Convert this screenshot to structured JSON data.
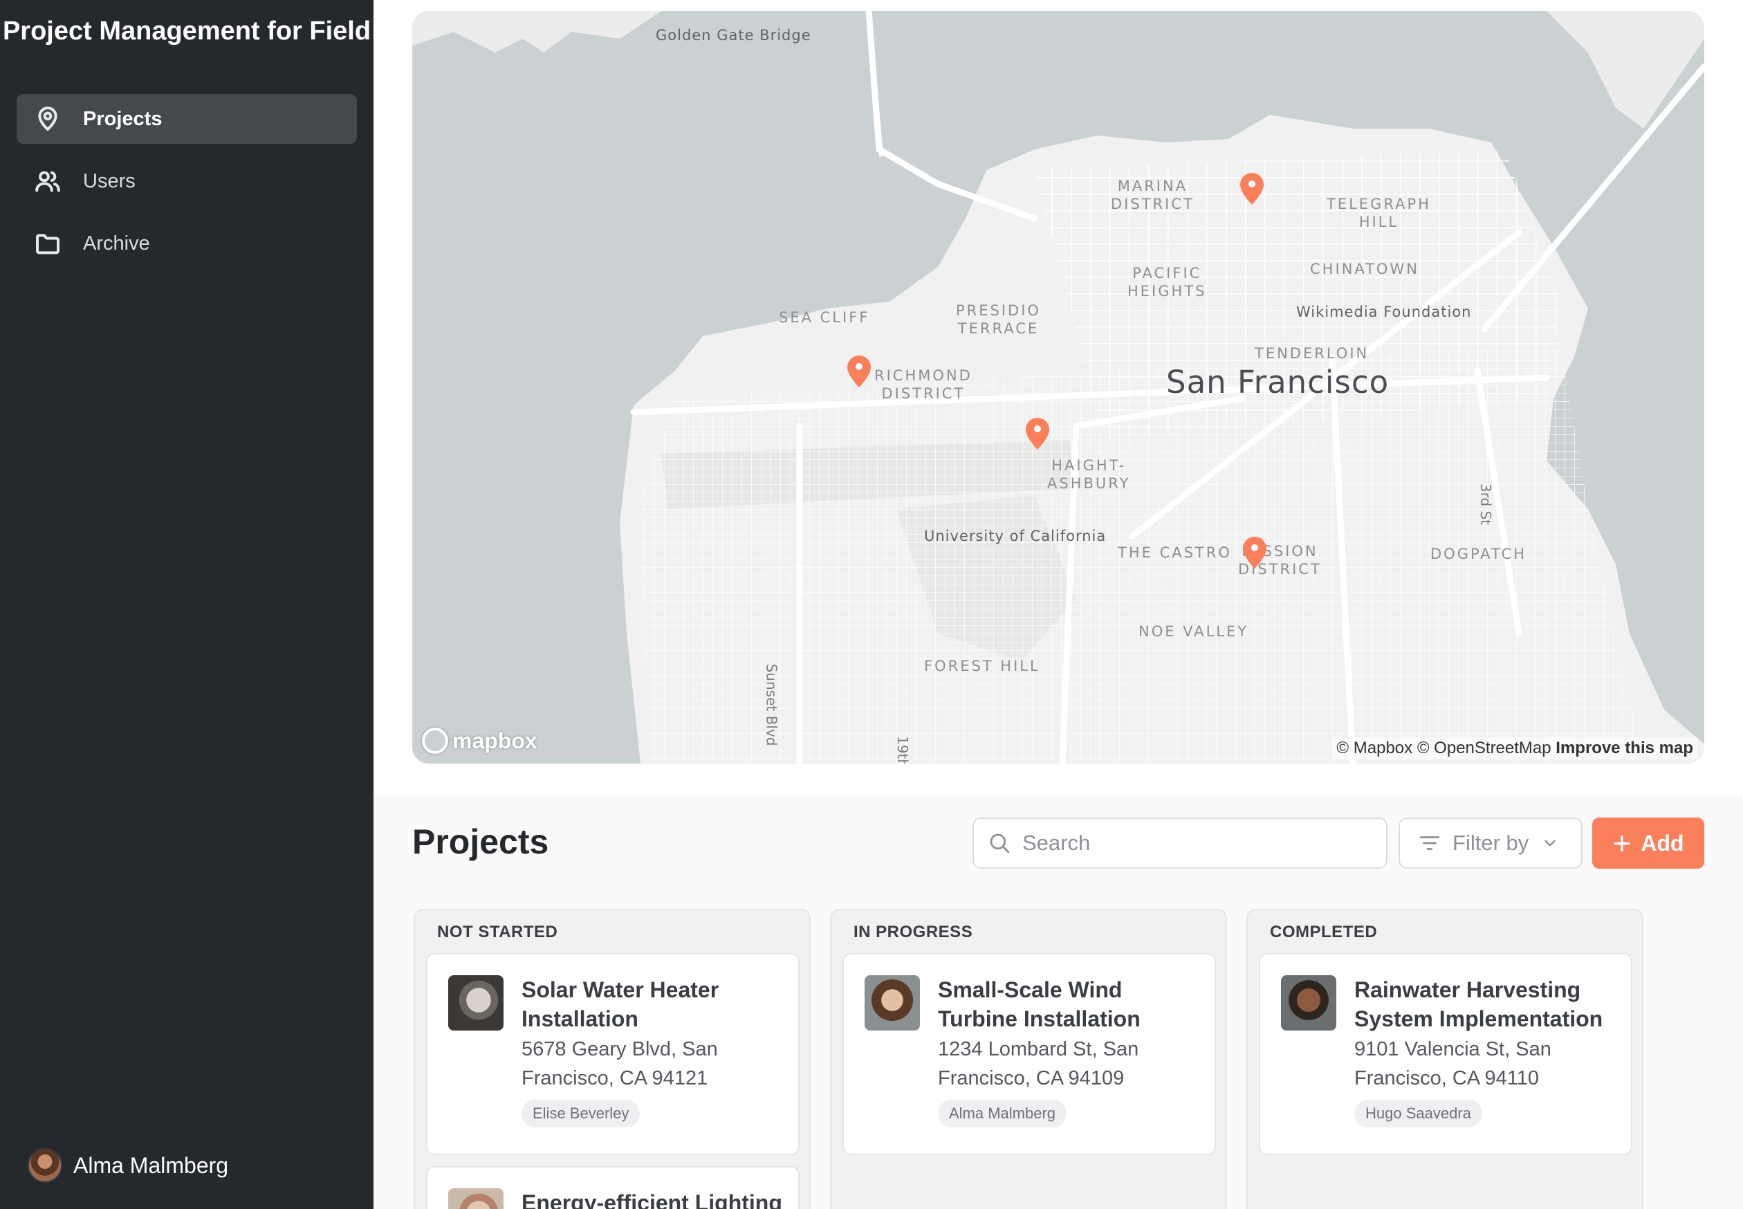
{
  "app": {
    "title": "Project Management for Field"
  },
  "sidebar": {
    "items": [
      {
        "label": "Projects",
        "icon": "map-pin-icon",
        "active": true
      },
      {
        "label": "Users",
        "icon": "users-icon",
        "active": false
      },
      {
        "label": "Archive",
        "icon": "folder-icon",
        "active": false
      }
    ],
    "user": {
      "name": "Alma Malmberg"
    }
  },
  "map": {
    "labels": {
      "golden_gate": "Golden Gate Bridge",
      "marina": "MARINA\nDISTRICT",
      "telegraph": "TELEGRAPH\nHILL",
      "pacific": "PACIFIC\nHEIGHTS",
      "chinatown": "CHINATOWN",
      "wikimedia": "Wikimedia Foundation",
      "sea_cliff": "SEA CLIFF",
      "presidio": "PRESIDIO\nTERRACE",
      "tenderloin": "TENDERLOIN",
      "richmond": "RICHMOND\nDISTRICT",
      "city": "San Francisco",
      "haight": "HAIGHT-\nASHBURY",
      "third_st": "3rd St",
      "ucsf": "University of California",
      "castro": "THE CASTRO",
      "mission": "MISSION\nDISTRICT",
      "dogpatch": "DOGPATCH",
      "noe": "NOE VALLEY",
      "forest": "FOREST HILL",
      "sunset_blvd": "Sunset Blvd",
      "nineteenth": "19th"
    },
    "logo": "mapbox",
    "attribution": "© Mapbox © OpenStreetMap",
    "improve": "Improve this map",
    "marker_color": "#fa7f5b"
  },
  "projects": {
    "title": "Projects",
    "search_placeholder": "Search",
    "filter_label": "Filter by",
    "add_label": "Add",
    "columns": [
      {
        "title": "NOT STARTED",
        "cards": [
          {
            "title": "Solar Water Heater Installation",
            "address": "5678 Geary Blvd, San Francisco, CA 94121",
            "assignee": "Elise Beverley"
          },
          {
            "title": "Energy-efficient Lighting",
            "address": "",
            "assignee": ""
          }
        ]
      },
      {
        "title": "IN PROGRESS",
        "cards": [
          {
            "title": "Small-Scale Wind Turbine Installation",
            "address": "1234 Lombard St, San Francisco, CA 94109",
            "assignee": "Alma Malmberg"
          }
        ]
      },
      {
        "title": "COMPLETED",
        "cards": [
          {
            "title": "Rainwater Harvesting System Implementation",
            "address": "9101 Valencia St, San Francisco, CA 94110",
            "assignee": "Hugo Saavedra"
          }
        ]
      }
    ]
  },
  "colors": {
    "sidebar_bg": "#25282c",
    "accent": "#fa7f5b",
    "active_nav": "#45484d"
  }
}
